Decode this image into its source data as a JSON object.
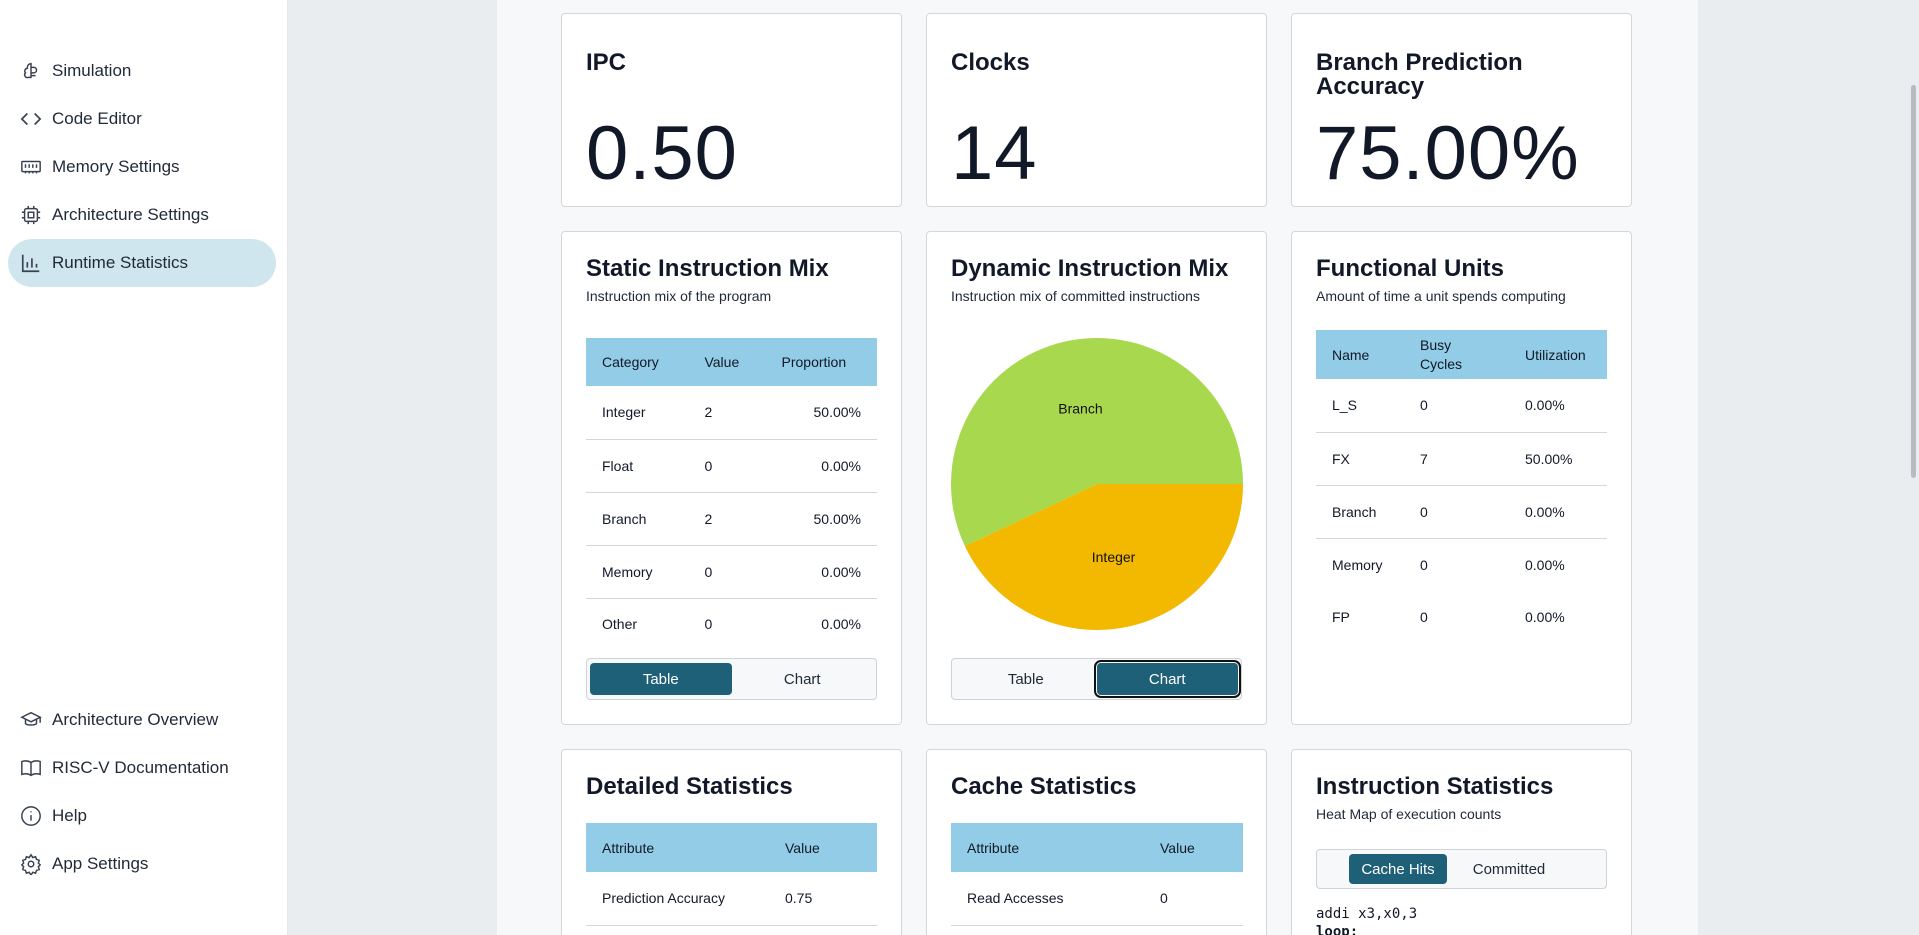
{
  "sidebar": {
    "top_items": [
      {
        "label": "Simulation",
        "icon": "brain-icon"
      },
      {
        "label": "Code Editor",
        "icon": "code-icon"
      },
      {
        "label": "Memory Settings",
        "icon": "memory-icon"
      },
      {
        "label": "Architecture Settings",
        "icon": "cpu-icon"
      },
      {
        "label": "Runtime Statistics",
        "icon": "chart-bar-icon",
        "active": true
      }
    ],
    "bottom_items": [
      {
        "label": "Architecture Overview",
        "icon": "graduation-cap-icon"
      },
      {
        "label": "RISC-V Documentation",
        "icon": "book-icon"
      },
      {
        "label": "Help",
        "icon": "info-icon"
      },
      {
        "label": "App Settings",
        "icon": "gear-icon"
      }
    ]
  },
  "kpis": {
    "ipc": {
      "title": "IPC",
      "value": "0.50"
    },
    "clocks": {
      "title": "Clocks",
      "value": "14"
    },
    "bpa": {
      "title_line1": "Branch Prediction",
      "title_line2": "Accuracy",
      "value": "75.00%"
    }
  },
  "static_mix": {
    "title": "Static Instruction Mix",
    "subtitle": "Instruction mix of the program",
    "headers": [
      "Category",
      "Value",
      "Proportion"
    ],
    "rows": [
      [
        "Integer",
        "2",
        "50.00%"
      ],
      [
        "Float",
        "0",
        "0.00%"
      ],
      [
        "Branch",
        "2",
        "50.00%"
      ],
      [
        "Memory",
        "0",
        "0.00%"
      ],
      [
        "Other",
        "0",
        "0.00%"
      ]
    ],
    "toggle": {
      "table": "Table",
      "chart": "Chart",
      "selected": "Table"
    }
  },
  "dynamic_mix": {
    "title": "Dynamic Instruction Mix",
    "subtitle": "Instruction mix of committed instructions",
    "toggle": {
      "table": "Table",
      "chart": "Chart",
      "selected": "Chart"
    }
  },
  "chart_data": {
    "type": "pie",
    "categories": [
      "Branch",
      "Integer"
    ],
    "values": [
      57,
      43
    ],
    "colors": [
      "#a8d84e",
      "#f2b900"
    ]
  },
  "functional_units": {
    "title": "Functional Units",
    "subtitle": "Amount of time a unit spends computing",
    "headers": [
      "Name",
      "Busy Cycles",
      "Utilization"
    ],
    "rows": [
      [
        "L_S",
        "0",
        "0.00%"
      ],
      [
        "FX",
        "7",
        "50.00%"
      ],
      [
        "Branch",
        "0",
        "0.00%"
      ],
      [
        "Memory",
        "0",
        "0.00%"
      ],
      [
        "FP",
        "0",
        "0.00%"
      ]
    ]
  },
  "detailed_stats": {
    "title": "Detailed Statistics",
    "headers": [
      "Attribute",
      "Value"
    ],
    "rows": [
      [
        "Prediction Accuracy",
        "0.75"
      ]
    ]
  },
  "cache_stats": {
    "title": "Cache Statistics",
    "headers": [
      "Attribute",
      "Value"
    ],
    "rows": [
      [
        "Read Accesses",
        "0"
      ]
    ]
  },
  "instruction_stats": {
    "title": "Instruction Statistics",
    "subtitle": "Heat Map of execution counts",
    "toggle": {
      "hits": "Cache Hits",
      "committed": "Committed",
      "selected": "Cache Hits"
    },
    "code": [
      "addi x3,x0,3",
      "loop:"
    ]
  },
  "colors": {
    "accent": "#1d6078",
    "table_header": "#93cce6",
    "active_nav": "#cfe6ee"
  }
}
